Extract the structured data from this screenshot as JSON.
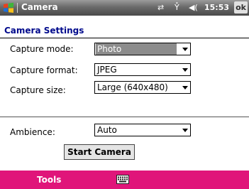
{
  "titlebar": {
    "app_title": "Camera",
    "clock": "15:53",
    "ok_label": "ok",
    "icons": [
      "windows-start-icon",
      "connectivity-icon",
      "signal-off-icon",
      "speaker-icon"
    ]
  },
  "page": {
    "heading": "Camera Settings"
  },
  "fields": {
    "capture_mode": {
      "label": "Capture mode:",
      "value": "Photo"
    },
    "capture_format": {
      "label": "Capture format:",
      "value": "JPEG"
    },
    "capture_size": {
      "label": "Capture size:",
      "value": "Large (640x480)"
    },
    "ambience": {
      "label": "Ambience:",
      "value": "Auto"
    }
  },
  "actions": {
    "start_camera": "Start Camera"
  },
  "softkeys": {
    "left": "Tools",
    "keyboard_icon": "keyboard-icon"
  },
  "colors": {
    "heading": "#000a8c",
    "bottom_bar": "#e0157a",
    "selection": "#8c8c8c"
  }
}
